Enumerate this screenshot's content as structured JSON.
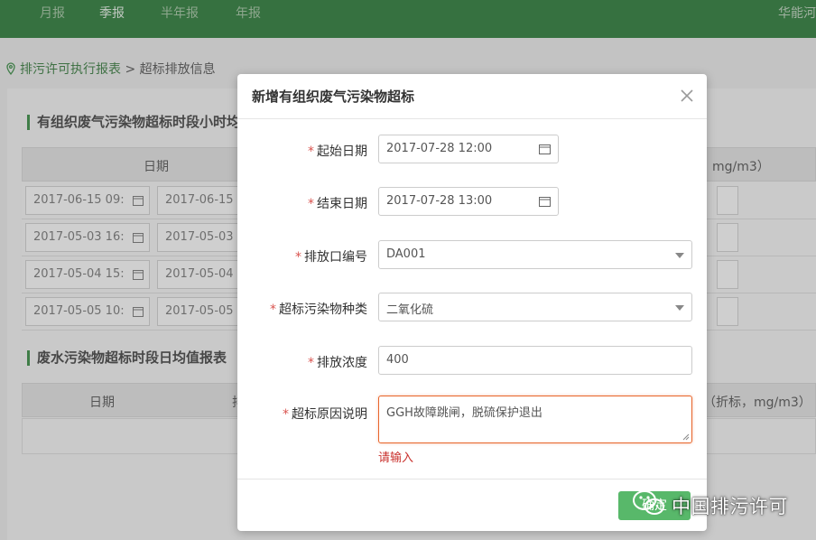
{
  "topbar": {
    "tabs": [
      "月报",
      "季报",
      "半年报",
      "年报"
    ],
    "user": "华能河"
  },
  "breadcrumb": {
    "link": "排污许可执行报表",
    "separator": ">",
    "current": "超标排放信息"
  },
  "background": {
    "section1_title": "有组织废气污染物超标时段小时均值",
    "section1_col_date": "日期",
    "section1_col_conc": "mg/m3）",
    "rows": [
      {
        "start": "2017-06-15 09:",
        "end": "2017-06-15 "
      },
      {
        "start": "2017-05-03 16:",
        "end": "2017-05-03 "
      },
      {
        "start": "2017-05-04 15:",
        "end": "2017-05-04 "
      },
      {
        "start": "2017-05-05 10:",
        "end": "2017-05-05 "
      }
    ],
    "section2_title": "废水污染物超标时段日均值报表",
    "section2_col_date": "日期",
    "section2_col_2": "排",
    "section2_col_conc": "（折标，mg/m3）"
  },
  "modal": {
    "title": "新增有组织废气污染物超标",
    "required_mark": "*",
    "fields": {
      "start_date": {
        "label": "起始日期",
        "value": "2017-07-28 12:00"
      },
      "end_date": {
        "label": "结束日期",
        "value": "2017-07-28 13:00"
      },
      "outlet_no": {
        "label": "排放口编号",
        "value": "DA001"
      },
      "pollutant": {
        "label": "超标污染物种类",
        "value": "二氧化硫"
      },
      "concentration": {
        "label": "排放浓度",
        "value": "400"
      },
      "reason": {
        "label": "超标原因说明",
        "value": "GGH故障跳闸，脱硫保护退出",
        "error": "请输入"
      }
    },
    "confirm_label": "确定"
  },
  "watermark": {
    "text": "中国排污许可"
  }
}
